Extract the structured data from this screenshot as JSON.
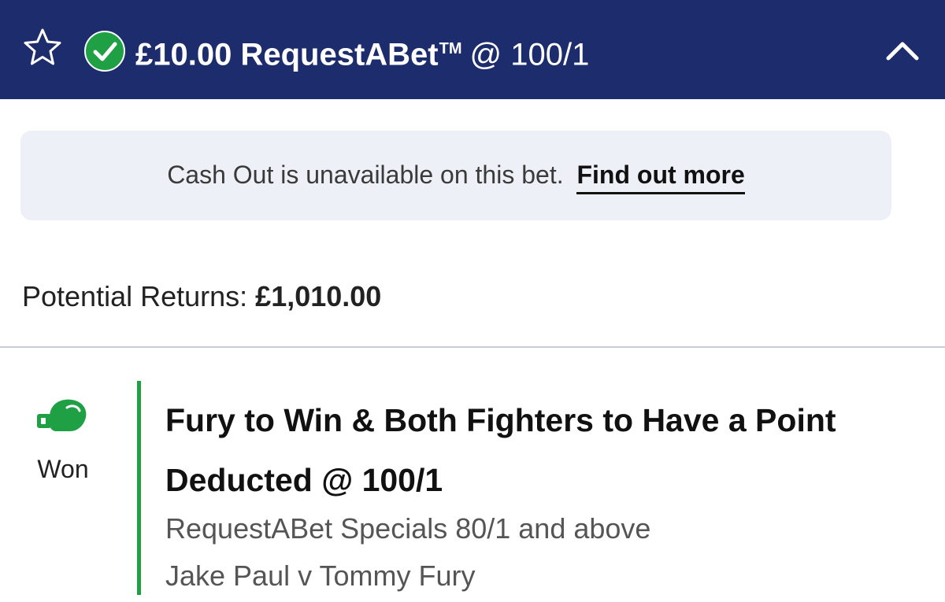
{
  "header": {
    "stake": "£10.00",
    "bet_type": "RequestABet",
    "trademark": "TM",
    "odds_text": "@ 100/1",
    "icons": [
      "star-icon",
      "check-icon",
      "chevron-up-icon"
    ],
    "background_color": "#1c2c6c"
  },
  "cashout": {
    "message": "Cash Out is unavailable on this bet.",
    "link_label": "Find out more"
  },
  "returns": {
    "label": "Potential Returns:",
    "value": "£1,010.00"
  },
  "selection": {
    "status_icon": "boxing-glove-icon",
    "status": "Won",
    "status_color": "#1fa045",
    "title": "Fury to Win & Both Fighters to Have a Point Deducted @ 100/1",
    "market": "RequestABet Specials 80/1 and above",
    "event": "Jake Paul v Tommy Fury"
  }
}
